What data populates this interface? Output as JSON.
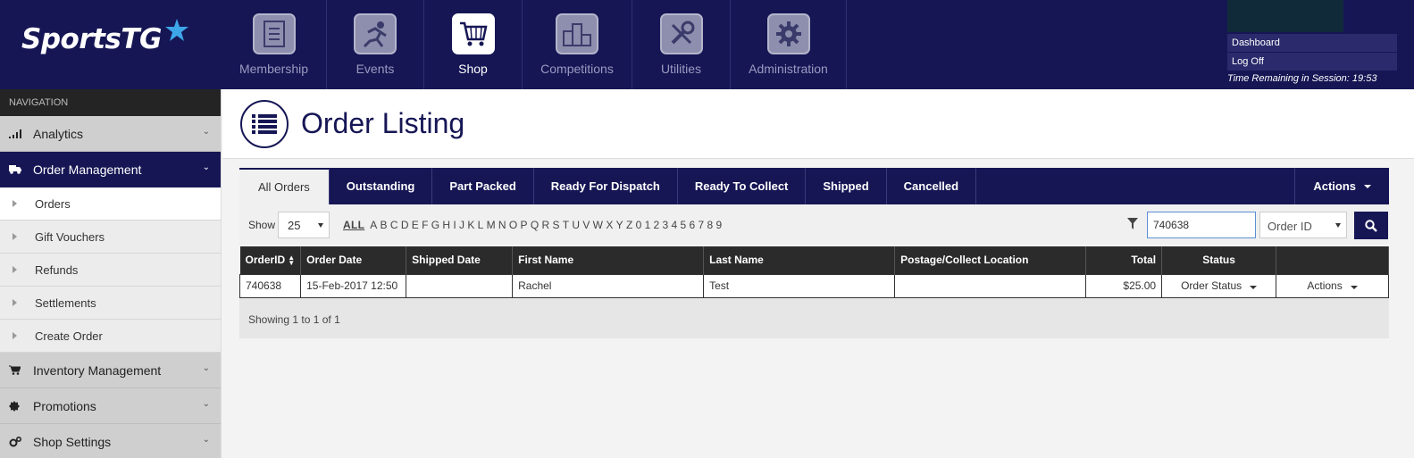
{
  "brand": {
    "name": "SportsTG"
  },
  "topnav": [
    {
      "label": "Membership",
      "icon": "membership-icon"
    },
    {
      "label": "Events",
      "icon": "events-icon"
    },
    {
      "label": "Shop",
      "icon": "shop-cart-icon",
      "active": true
    },
    {
      "label": "Competitions",
      "icon": "podium-icon"
    },
    {
      "label": "Utilities",
      "icon": "tools-icon"
    },
    {
      "label": "Administration",
      "icon": "gear-icon"
    }
  ],
  "session": {
    "dashboard": "Dashboard",
    "logoff": "Log Off",
    "time_remaining": "Time Remaining in Session: 19:53"
  },
  "sidebar": {
    "heading": "NAVIGATION",
    "analytics": "Analytics",
    "order_management": "Order Management",
    "items": [
      "Orders",
      "Gift Vouchers",
      "Refunds",
      "Settlements",
      "Create Order"
    ],
    "inventory": "Inventory Management",
    "promotions": "Promotions",
    "shop_settings": "Shop Settings"
  },
  "page": {
    "title": "Order Listing"
  },
  "tabs": [
    "All Orders",
    "Outstanding",
    "Part Packed",
    "Ready For Dispatch",
    "Ready To Collect",
    "Shipped",
    "Cancelled"
  ],
  "tabs_actions": "Actions",
  "filter": {
    "show_label": "Show",
    "show_value": "25",
    "all_label": "ALL",
    "letters": [
      "A",
      "B",
      "C",
      "D",
      "E",
      "F",
      "G",
      "H",
      "I",
      "J",
      "K",
      "L",
      "M",
      "N",
      "O",
      "P",
      "Q",
      "R",
      "S",
      "T",
      "U",
      "V",
      "W",
      "X",
      "Y",
      "Z",
      "0",
      "1",
      "2",
      "3",
      "4",
      "5",
      "6",
      "7",
      "8",
      "9"
    ],
    "search_value": "740638",
    "field_value": "Order ID"
  },
  "table": {
    "headers": [
      "OrderID",
      "Order Date",
      "Shipped Date",
      "First Name",
      "Last Name",
      "Postage/Collect Location",
      "Total",
      "Status",
      ""
    ],
    "rows": [
      {
        "order_id": "740638",
        "order_date": "15-Feb-2017 12:50",
        "shipped_date": "",
        "first_name": "Rachel",
        "last_name": "Test",
        "location": "",
        "total": "$25.00",
        "status": "Order Status",
        "actions": "Actions"
      }
    ]
  },
  "footer": {
    "showing": "Showing 1 to 1 of 1"
  },
  "colors": {
    "navy": "#161655",
    "dark": "#2b2b2b",
    "search_border": "#5b8fd6"
  }
}
